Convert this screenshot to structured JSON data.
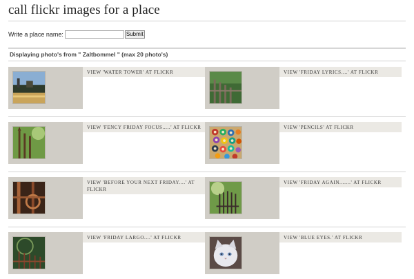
{
  "page": {
    "title": "call flickr images for a place",
    "search": {
      "label": "Write a place name:",
      "value": "",
      "placeholder": "",
      "button": "Submit"
    },
    "heading": "Displaying photo's from \" Zaltbommel \" (max 20 photo's)"
  },
  "photos": [
    {
      "caption": "View 'Water Tower' at Flickr",
      "icon": "water-tower-photo",
      "colors": [
        "#6f8fb7",
        "#2e3a2a",
        "#d8b060"
      ]
    },
    {
      "caption": "View 'Friday Lyrics....' at Flickr",
      "icon": "fence-photo",
      "colors": [
        "#4b7a3c",
        "#6b5a4a",
        "#9a8a7a"
      ]
    },
    {
      "caption": "View 'Fency Friday Focus.....' at Flickr",
      "icon": "rusty-fence-photo",
      "colors": [
        "#5c8b3a",
        "#6a4a2a",
        "#9bb86a"
      ]
    },
    {
      "caption": "View 'Pencils' at Flickr",
      "icon": "pencils-photo",
      "colors": [
        "#c9a26a",
        "#b84a3a",
        "#4a8a6a"
      ]
    },
    {
      "caption": "View 'Before your next Friday....' at Flickr",
      "icon": "rusty-gate-photo",
      "colors": [
        "#4a3020",
        "#b06a3a",
        "#7a4a2a"
      ]
    },
    {
      "caption": "View 'Friday again.......' at Flickr",
      "icon": "railing-photo",
      "colors": [
        "#5a8a3a",
        "#3a2a2a",
        "#aac07a"
      ]
    },
    {
      "caption": "View 'Friday Largo....' at Flickr",
      "icon": "iron-fence-photo",
      "colors": [
        "#2a4a2a",
        "#6a3a2a",
        "#8aa86a"
      ]
    },
    {
      "caption": "View 'Blue eyes.' at Flickr",
      "icon": "cat-photo",
      "colors": [
        "#5a4a4a",
        "#e0e0e8",
        "#a6b8d0"
      ]
    }
  ]
}
